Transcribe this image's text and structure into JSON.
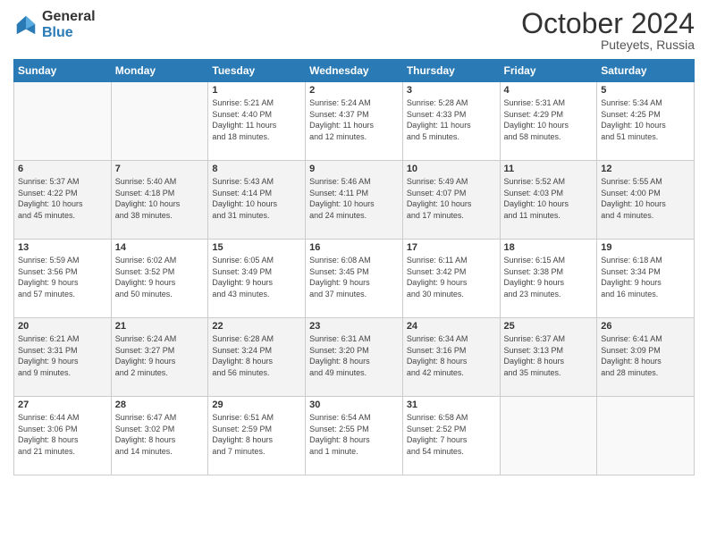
{
  "logo": {
    "general": "General",
    "blue": "Blue"
  },
  "header": {
    "month": "October 2024",
    "location": "Puteyets, Russia"
  },
  "weekdays": [
    "Sunday",
    "Monday",
    "Tuesday",
    "Wednesday",
    "Thursday",
    "Friday",
    "Saturday"
  ],
  "weeks": [
    [
      {
        "day": "",
        "detail": ""
      },
      {
        "day": "",
        "detail": ""
      },
      {
        "day": "1",
        "detail": "Sunrise: 5:21 AM\nSunset: 4:40 PM\nDaylight: 11 hours\nand 18 minutes."
      },
      {
        "day": "2",
        "detail": "Sunrise: 5:24 AM\nSunset: 4:37 PM\nDaylight: 11 hours\nand 12 minutes."
      },
      {
        "day": "3",
        "detail": "Sunrise: 5:28 AM\nSunset: 4:33 PM\nDaylight: 11 hours\nand 5 minutes."
      },
      {
        "day": "4",
        "detail": "Sunrise: 5:31 AM\nSunset: 4:29 PM\nDaylight: 10 hours\nand 58 minutes."
      },
      {
        "day": "5",
        "detail": "Sunrise: 5:34 AM\nSunset: 4:25 PM\nDaylight: 10 hours\nand 51 minutes."
      }
    ],
    [
      {
        "day": "6",
        "detail": "Sunrise: 5:37 AM\nSunset: 4:22 PM\nDaylight: 10 hours\nand 45 minutes."
      },
      {
        "day": "7",
        "detail": "Sunrise: 5:40 AM\nSunset: 4:18 PM\nDaylight: 10 hours\nand 38 minutes."
      },
      {
        "day": "8",
        "detail": "Sunrise: 5:43 AM\nSunset: 4:14 PM\nDaylight: 10 hours\nand 31 minutes."
      },
      {
        "day": "9",
        "detail": "Sunrise: 5:46 AM\nSunset: 4:11 PM\nDaylight: 10 hours\nand 24 minutes."
      },
      {
        "day": "10",
        "detail": "Sunrise: 5:49 AM\nSunset: 4:07 PM\nDaylight: 10 hours\nand 17 minutes."
      },
      {
        "day": "11",
        "detail": "Sunrise: 5:52 AM\nSunset: 4:03 PM\nDaylight: 10 hours\nand 11 minutes."
      },
      {
        "day": "12",
        "detail": "Sunrise: 5:55 AM\nSunset: 4:00 PM\nDaylight: 10 hours\nand 4 minutes."
      }
    ],
    [
      {
        "day": "13",
        "detail": "Sunrise: 5:59 AM\nSunset: 3:56 PM\nDaylight: 9 hours\nand 57 minutes."
      },
      {
        "day": "14",
        "detail": "Sunrise: 6:02 AM\nSunset: 3:52 PM\nDaylight: 9 hours\nand 50 minutes."
      },
      {
        "day": "15",
        "detail": "Sunrise: 6:05 AM\nSunset: 3:49 PM\nDaylight: 9 hours\nand 43 minutes."
      },
      {
        "day": "16",
        "detail": "Sunrise: 6:08 AM\nSunset: 3:45 PM\nDaylight: 9 hours\nand 37 minutes."
      },
      {
        "day": "17",
        "detail": "Sunrise: 6:11 AM\nSunset: 3:42 PM\nDaylight: 9 hours\nand 30 minutes."
      },
      {
        "day": "18",
        "detail": "Sunrise: 6:15 AM\nSunset: 3:38 PM\nDaylight: 9 hours\nand 23 minutes."
      },
      {
        "day": "19",
        "detail": "Sunrise: 6:18 AM\nSunset: 3:34 PM\nDaylight: 9 hours\nand 16 minutes."
      }
    ],
    [
      {
        "day": "20",
        "detail": "Sunrise: 6:21 AM\nSunset: 3:31 PM\nDaylight: 9 hours\nand 9 minutes."
      },
      {
        "day": "21",
        "detail": "Sunrise: 6:24 AM\nSunset: 3:27 PM\nDaylight: 9 hours\nand 2 minutes."
      },
      {
        "day": "22",
        "detail": "Sunrise: 6:28 AM\nSunset: 3:24 PM\nDaylight: 8 hours\nand 56 minutes."
      },
      {
        "day": "23",
        "detail": "Sunrise: 6:31 AM\nSunset: 3:20 PM\nDaylight: 8 hours\nand 49 minutes."
      },
      {
        "day": "24",
        "detail": "Sunrise: 6:34 AM\nSunset: 3:16 PM\nDaylight: 8 hours\nand 42 minutes."
      },
      {
        "day": "25",
        "detail": "Sunrise: 6:37 AM\nSunset: 3:13 PM\nDaylight: 8 hours\nand 35 minutes."
      },
      {
        "day": "26",
        "detail": "Sunrise: 6:41 AM\nSunset: 3:09 PM\nDaylight: 8 hours\nand 28 minutes."
      }
    ],
    [
      {
        "day": "27",
        "detail": "Sunrise: 6:44 AM\nSunset: 3:06 PM\nDaylight: 8 hours\nand 21 minutes."
      },
      {
        "day": "28",
        "detail": "Sunrise: 6:47 AM\nSunset: 3:02 PM\nDaylight: 8 hours\nand 14 minutes."
      },
      {
        "day": "29",
        "detail": "Sunrise: 6:51 AM\nSunset: 2:59 PM\nDaylight: 8 hours\nand 7 minutes."
      },
      {
        "day": "30",
        "detail": "Sunrise: 6:54 AM\nSunset: 2:55 PM\nDaylight: 8 hours\nand 1 minute."
      },
      {
        "day": "31",
        "detail": "Sunrise: 6:58 AM\nSunset: 2:52 PM\nDaylight: 7 hours\nand 54 minutes."
      },
      {
        "day": "",
        "detail": ""
      },
      {
        "day": "",
        "detail": ""
      }
    ]
  ]
}
